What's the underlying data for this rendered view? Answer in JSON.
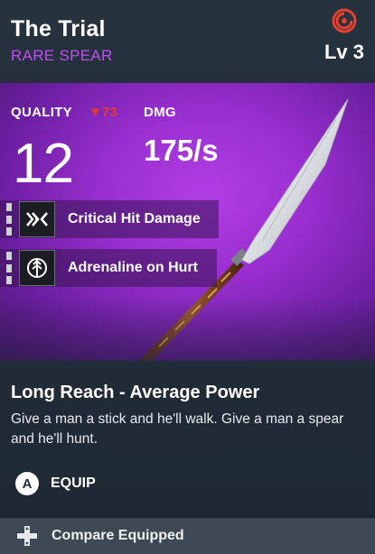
{
  "item": {
    "name": "The Trial",
    "rarity": "RARE SPEAR",
    "level": "Lv 3"
  },
  "stats": {
    "quality_label": "QUALITY",
    "quality_delta": "▼73",
    "quality_value": "12",
    "dmg_label": "DMG",
    "dmg_value": "175/s"
  },
  "perks": [
    {
      "label": "Critical Hit Damage",
      "icon": "critical-hit-icon"
    },
    {
      "label": "Adrenaline on Hurt",
      "icon": "adrenaline-icon"
    }
  ],
  "description": {
    "title": "Long Reach - Average Power",
    "text": "Give a man a stick and he'll walk. Give a man a spear and he'll hunt."
  },
  "actions": {
    "equip_button": "A",
    "equip_label": "EQUIP",
    "compare_label": "Compare Equipped"
  },
  "colors": {
    "rarity": "#c14df0",
    "delta": "#e23a2e",
    "background": "#1f2b36",
    "item_bg": "#9a2fd0"
  }
}
